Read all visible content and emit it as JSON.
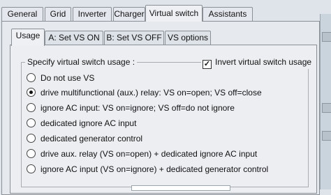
{
  "main_tabs": [
    "General",
    "Grid",
    "Inverter",
    "Charger",
    "Virtual switch",
    "Assistants"
  ],
  "sub_tabs": [
    "Usage",
    "A:  Set VS ON",
    "B:  Set VS OFF",
    "VS options"
  ],
  "usage": {
    "group_label": "Specify virtual switch usage :",
    "invert_label": "Invert virtual switch usage",
    "invert_checked": true,
    "options": [
      {
        "label": "Do not use VS",
        "selected": false
      },
      {
        "label": "drive multifunctional (aux.) relay: VS on=open; VS off=close",
        "selected": true
      },
      {
        "label": "ignore AC input: VS on=ignore;  VS off=do not ignore",
        "selected": false
      },
      {
        "label": "dedicated ignore AC input",
        "selected": false
      },
      {
        "label": "dedicated generator control",
        "selected": false
      },
      {
        "label": "drive aux. relay (VS on=open) + dedicated ignore AC input",
        "selected": false
      },
      {
        "label": "ignore AC input (VS on=ignore) + dedicated generator control",
        "selected": false
      }
    ]
  },
  "invert_check_mark": "✓"
}
